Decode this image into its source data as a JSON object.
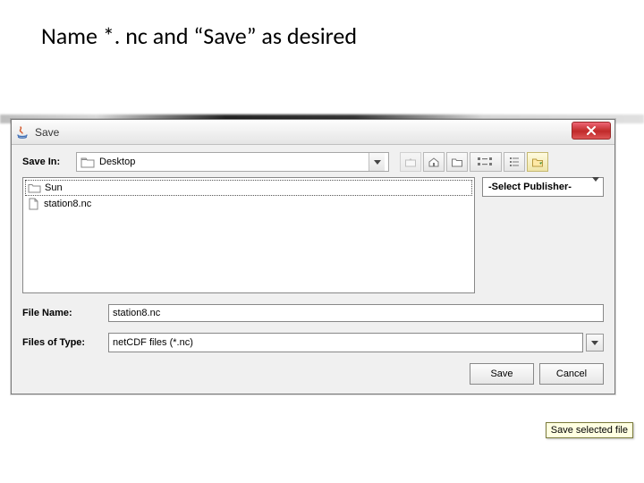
{
  "caption": "Name *. nc and “Save” as desired",
  "dialog": {
    "title": "Save",
    "save_in_label": "Save In:",
    "location_value": "Desktop",
    "publisher_combo": "-Select Publisher-",
    "file_items": [
      {
        "name": "Sun",
        "kind": "folder"
      },
      {
        "name": "station8.nc",
        "kind": "file"
      }
    ],
    "filename_label": "File Name:",
    "filename_value": "station8.nc",
    "filetype_label": "Files of Type:",
    "filetype_value": "netCDF files (*.nc)",
    "save_button": "Save",
    "cancel_button": "Cancel",
    "tooltip": "Save selected file"
  }
}
